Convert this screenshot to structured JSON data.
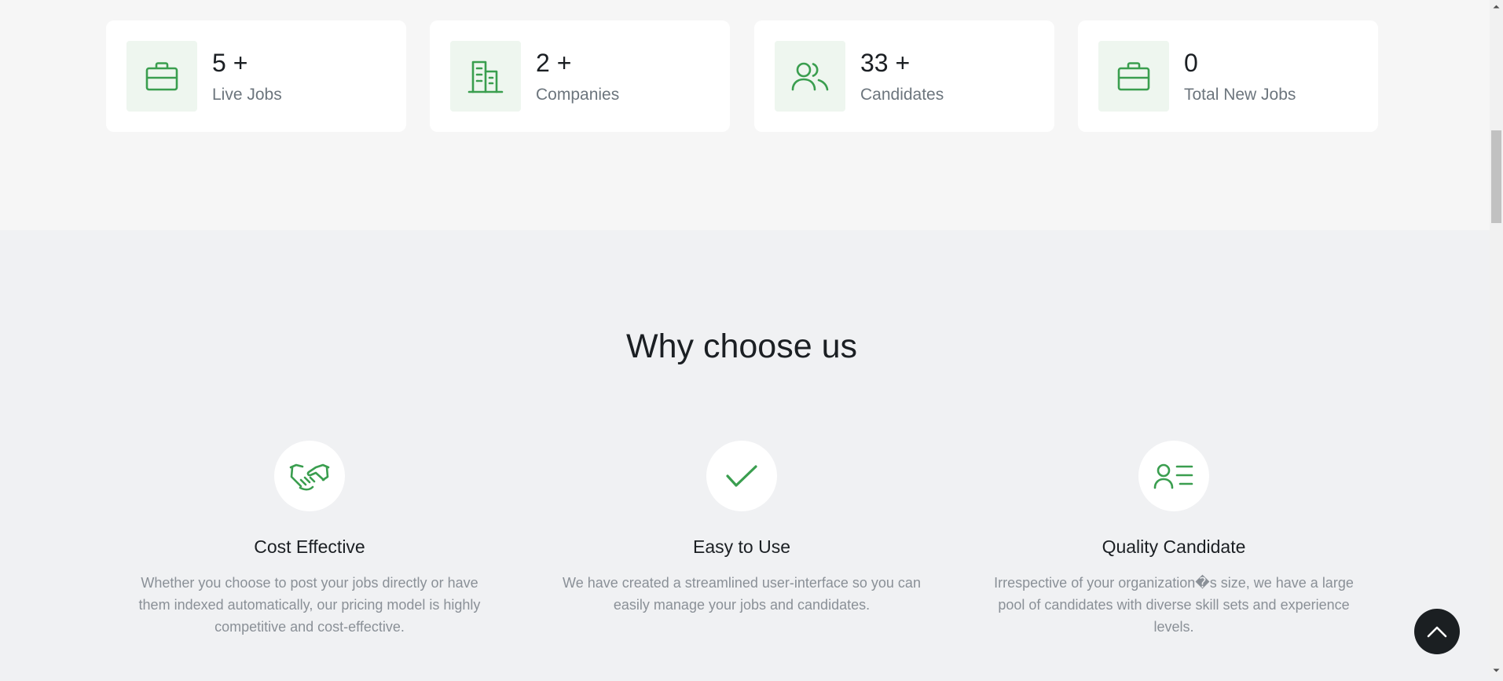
{
  "stats": [
    {
      "value": "5 +",
      "label": "Live Jobs",
      "icon": "briefcase-icon"
    },
    {
      "value": "2 +",
      "label": "Companies",
      "icon": "building-icon"
    },
    {
      "value": "33 +",
      "label": "Candidates",
      "icon": "people-icon"
    },
    {
      "value": "0",
      "label": "Total New Jobs",
      "icon": "briefcase-icon"
    }
  ],
  "why": {
    "title": "Why choose us",
    "features": [
      {
        "title": "Cost Effective",
        "icon": "handshake-icon",
        "description": "Whether you choose to post your jobs directly or have them indexed automatically, our pricing model is highly competitive and cost-effective."
      },
      {
        "title": "Easy to Use",
        "icon": "checkmark-icon",
        "description": "We have created a streamlined user-interface so you can easily manage your jobs and candidates."
      },
      {
        "title": "Quality Candidate",
        "icon": "person-list-icon",
        "description": "Irrespective of your organization�s size, we have a large pool of candidates with diverse skill sets and experience levels."
      }
    ]
  },
  "colors": {
    "accent": "#3a9e4f",
    "icon_bg": "#eef6ef",
    "dark_button": "#1b1f22"
  },
  "back_to_top": {
    "icon": "chevron-up-icon"
  }
}
